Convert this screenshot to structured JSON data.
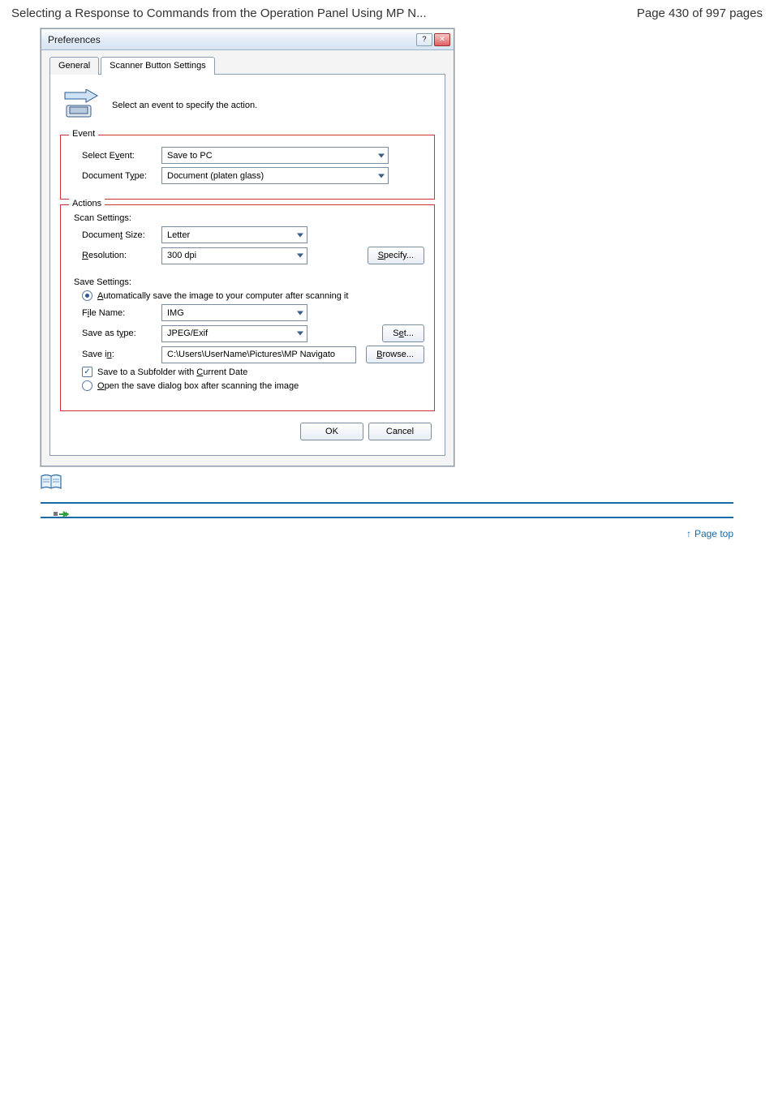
{
  "header": {
    "title": "Selecting a Response to Commands from the Operation Panel Using MP N...",
    "page_info": "Page 430 of 997 pages"
  },
  "dialog": {
    "title": "Preferences",
    "tabs": {
      "general": "General",
      "scanner": "Scanner Button Settings"
    },
    "intro": "Select an event to specify the action.",
    "event": {
      "legend": "Event",
      "select_event_label": "Select Event:",
      "select_event_value": "Save to PC",
      "document_type_label": "Document Type:",
      "document_type_value": "Document (platen glass)"
    },
    "actions": {
      "legend": "Actions",
      "scan_settings_label": "Scan Settings:",
      "document_size_label": "Document Size:",
      "document_size_value": "Letter",
      "resolution_label": "Resolution:",
      "resolution_value": "300 dpi",
      "specify_btn": "Specify...",
      "save_settings_label": "Save Settings:",
      "auto_save_option": "Automatically save the image to your computer after scanning it",
      "file_name_label": "File Name:",
      "file_name_value": "IMG",
      "save_as_type_label": "Save as type:",
      "save_as_type_value": "JPEG/Exif",
      "set_btn": "Set...",
      "save_in_label": "Save in:",
      "save_in_value": "C:\\Users\\UserName\\Pictures\\MP Navigato",
      "browse_btn": "Browse...",
      "subfolder_option": "Save to a Subfolder with Current Date",
      "open_dialog_option": "Open the save dialog box after scanning the image"
    },
    "footer": {
      "ok": "OK",
      "cancel": "Cancel"
    }
  },
  "note_block": {
    "bullet_heading": "",
    "items": [
      "",
      "",
      ""
    ]
  },
  "toplink": {
    "label": "Page top",
    "arrow": "↑"
  }
}
